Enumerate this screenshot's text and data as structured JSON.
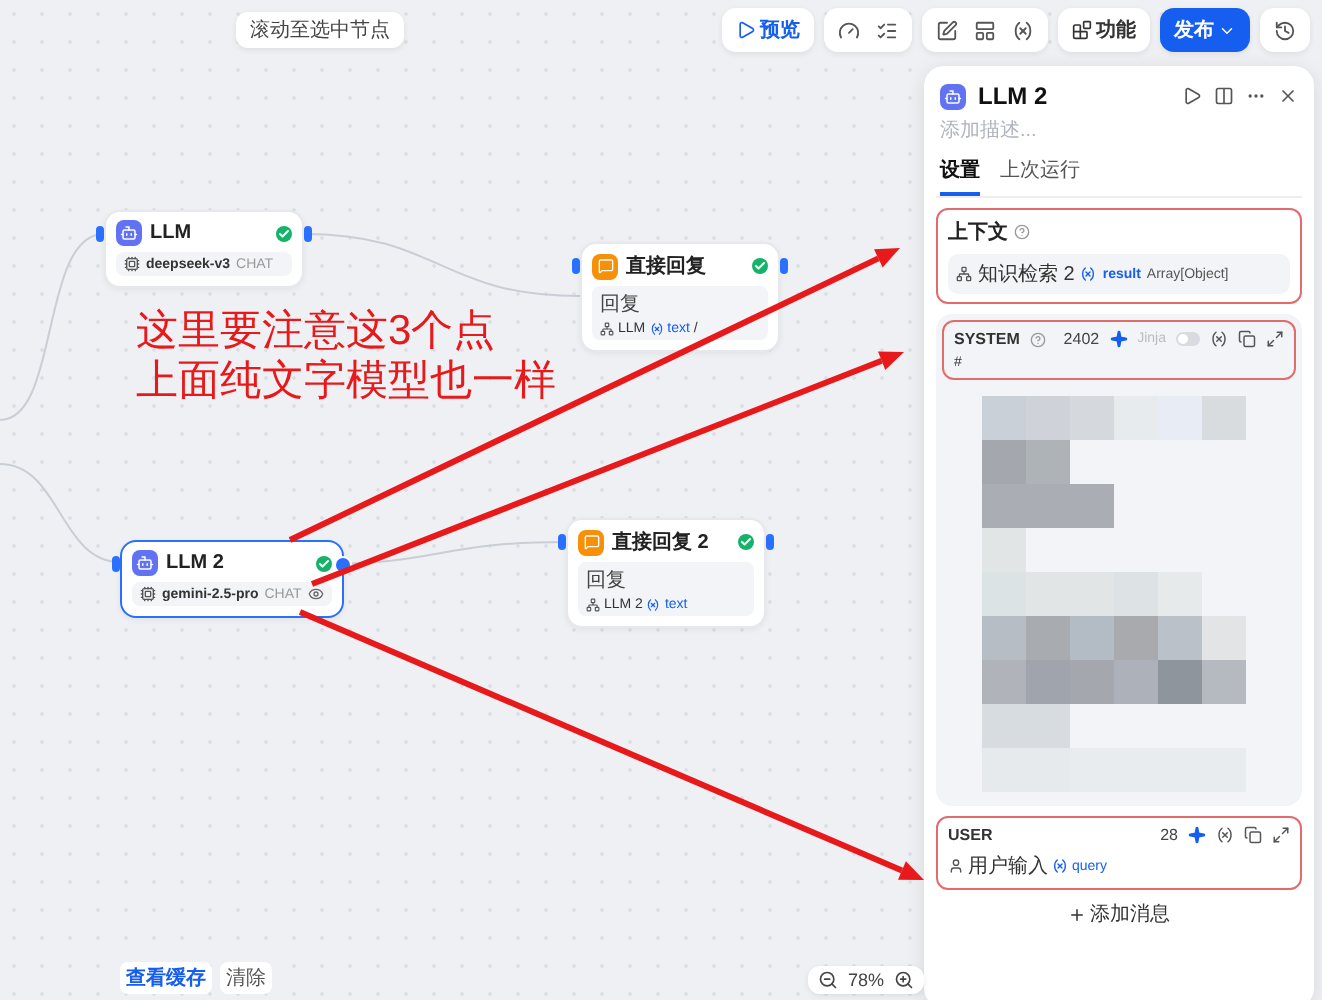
{
  "toolbar": {
    "hint": "滚动至选中节点",
    "preview": "预览",
    "features": "功能",
    "publish": "发布"
  },
  "nodes": [
    {
      "kind": "llm",
      "title": "LLM",
      "model": "deepseek-v3",
      "mode": "CHAT",
      "vision": false,
      "selected": false,
      "succeeded": true
    },
    {
      "kind": "answer",
      "title": "直接回复",
      "label": "回复",
      "source": "LLM",
      "variable": "text",
      "suffix": "/",
      "selected": false,
      "succeeded": true
    },
    {
      "kind": "llm",
      "title": "LLM 2",
      "model": "gemini-2.5-pro",
      "mode": "CHAT",
      "vision": true,
      "selected": true,
      "succeeded": true
    },
    {
      "kind": "answer",
      "title": "直接回复 2",
      "label": "回复",
      "source": "LLM 2",
      "variable": "text",
      "selected": false,
      "succeeded": true
    }
  ],
  "annotation": {
    "lines": [
      "这里要注意这3个点",
      "上面纯文字模型也一样"
    ]
  },
  "panel": {
    "title": "LLM 2",
    "description_placeholder": "添加描述...",
    "tabs": [
      {
        "label": "设置",
        "selected": true
      },
      {
        "label": "上次运行",
        "selected": false
      }
    ],
    "context": {
      "label": "上下文",
      "node": "知识检索 2",
      "variable": "result",
      "type": "Array[Object]"
    },
    "messages": [
      {
        "kind": "system",
        "role": "SYSTEM",
        "count": "2402",
        "jinja": {
          "label": "Jinja",
          "on": false
        },
        "first_line": "#"
      },
      {
        "kind": "user",
        "role": "USER",
        "count": "28",
        "node": "用户输入",
        "variable": "query"
      }
    ],
    "add_message": "添加消息"
  },
  "footer": {
    "cache": "查看缓存",
    "clear": "清除",
    "zoom": "78%"
  }
}
